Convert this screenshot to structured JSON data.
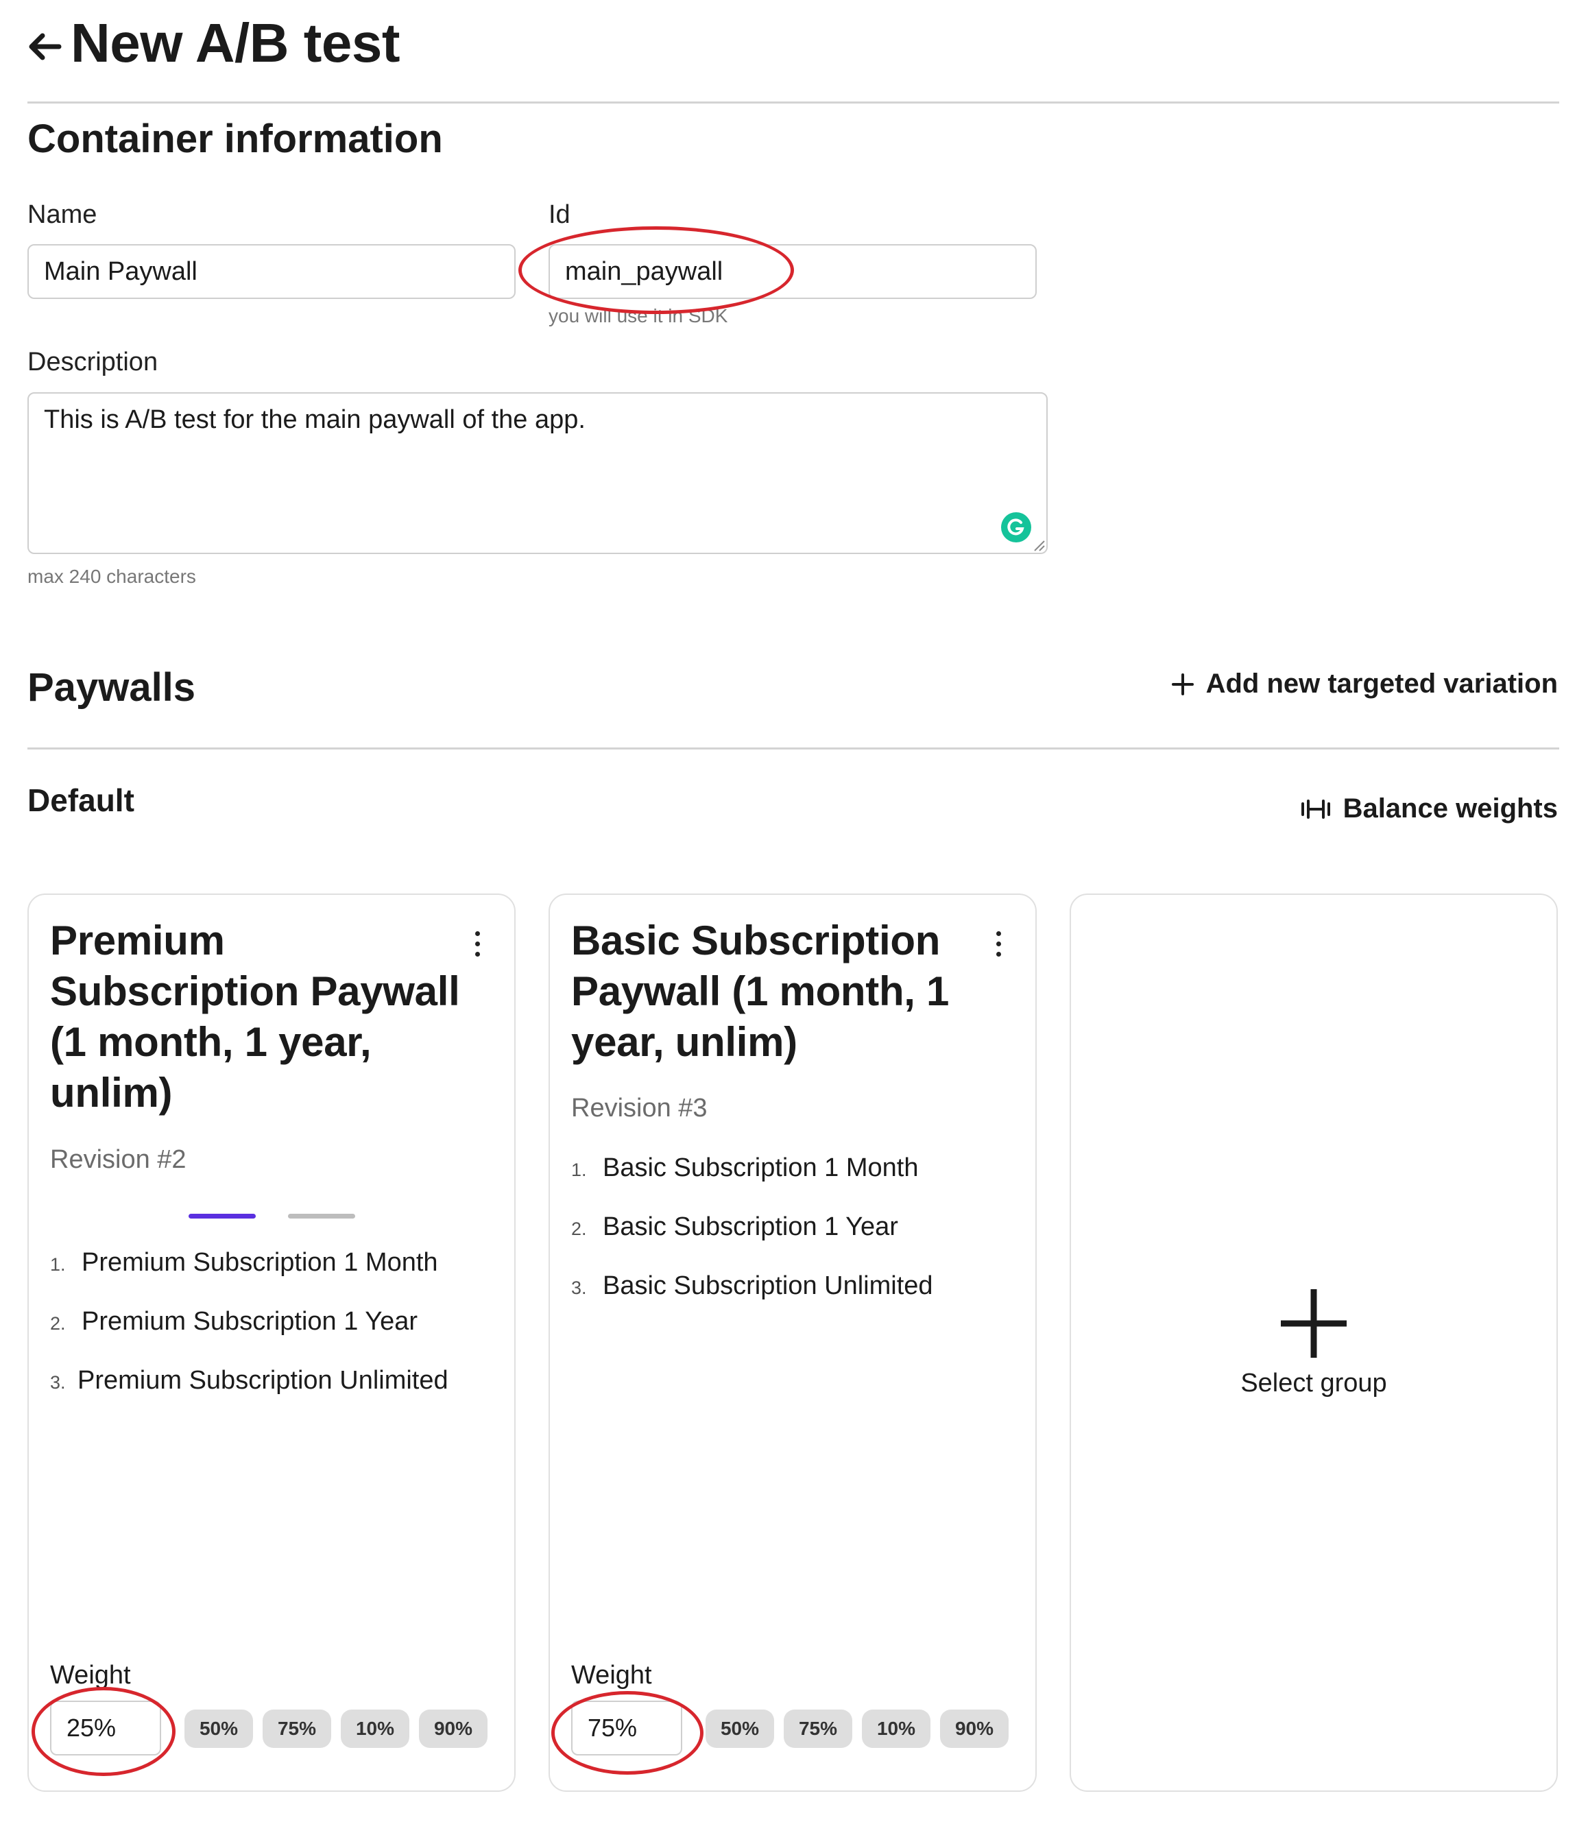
{
  "header": {
    "title": "New A/B test"
  },
  "container": {
    "title": "Container information",
    "name_label": "Name",
    "name_value": "Main Paywall",
    "id_label": "Id",
    "id_value": "main_paywall",
    "id_helper": "you will use it in SDK",
    "description_label": "Description",
    "description_value": "This is A/B test for the main paywall of the app.",
    "description_helper": "max 240 characters"
  },
  "paywalls": {
    "title": "Paywalls",
    "add_variation_label": "Add new targeted variation",
    "default_label": "Default",
    "balance_label": "Balance weights"
  },
  "cards": [
    {
      "title_lines": [
        "Premium",
        "Subscription Paywall",
        "(1 month, 1 year,",
        "unlim)"
      ],
      "revision": "Revision #2",
      "items": [
        {
          "num": "1.",
          "text": "Premium Subscription 1 Month"
        },
        {
          "num": "2.",
          "text": "Premium Subscription 1 Year"
        },
        {
          "num": "3.",
          "text": "Premium Subscription Unlimited"
        }
      ],
      "weight_label": "Weight",
      "weight_value": "25%",
      "chips": [
        "50%",
        "75%",
        "10%",
        "90%"
      ]
    },
    {
      "title_lines": [
        "Basic Subscription",
        "Paywall (1 month, 1",
        "year, unlim)"
      ],
      "revision": "Revision #3",
      "items": [
        {
          "num": "1.",
          "text": "Basic Subscription 1 Month"
        },
        {
          "num": "2.",
          "text": "Basic Subscription 1 Year"
        },
        {
          "num": "3.",
          "text": "Basic Subscription Unlimited"
        }
      ],
      "weight_label": "Weight",
      "weight_value": "75%",
      "chips": [
        "50%",
        "75%",
        "10%",
        "90%"
      ]
    }
  ],
  "add_group": {
    "label": "Select group"
  },
  "colors": {
    "accent": "#5a2fe0",
    "annotation_ring": "#d7262d",
    "grammarly": "#15c39a"
  }
}
